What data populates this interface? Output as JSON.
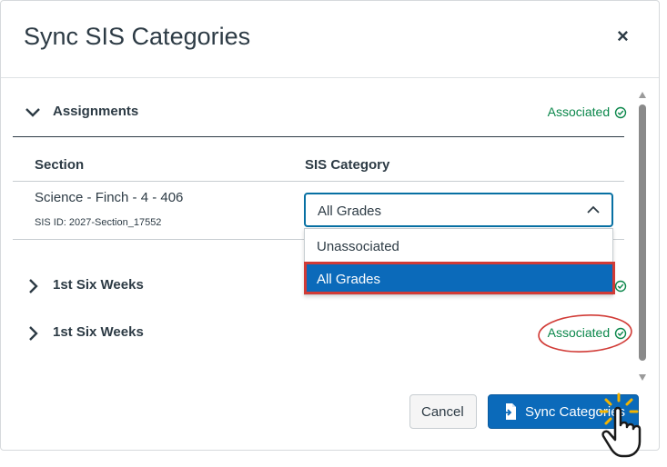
{
  "dialog": {
    "title": "Sync SIS Categories",
    "close_label": "×"
  },
  "groups": [
    {
      "label": "Assignments",
      "status": "Associated",
      "expanded": true
    },
    {
      "label": "1st Six Weeks",
      "status": "",
      "expanded": false
    },
    {
      "label": "1st Six Weeks",
      "status": "Associated",
      "expanded": false
    }
  ],
  "table": {
    "headers": [
      "Section",
      "SIS Category"
    ],
    "rows": [
      {
        "section": "Science - Finch - 4 - 406",
        "sis_id": "SIS ID: 2027-Section_17552",
        "category": "All Grades"
      }
    ]
  },
  "dropdown": {
    "options": [
      "Unassociated",
      "All Grades"
    ],
    "selected": "All Grades"
  },
  "footer": {
    "cancel_label": "Cancel",
    "sync_label": "Sync Categories"
  },
  "colors": {
    "primary": "#0b6aba",
    "success": "#0b874b",
    "highlight": "#d13b36"
  },
  "icons": {
    "close": "close-icon",
    "chevron": "chevron-icon",
    "status": "clock-check-icon",
    "sync": "document-import-icon",
    "pointer": "hand-pointer-icon"
  }
}
